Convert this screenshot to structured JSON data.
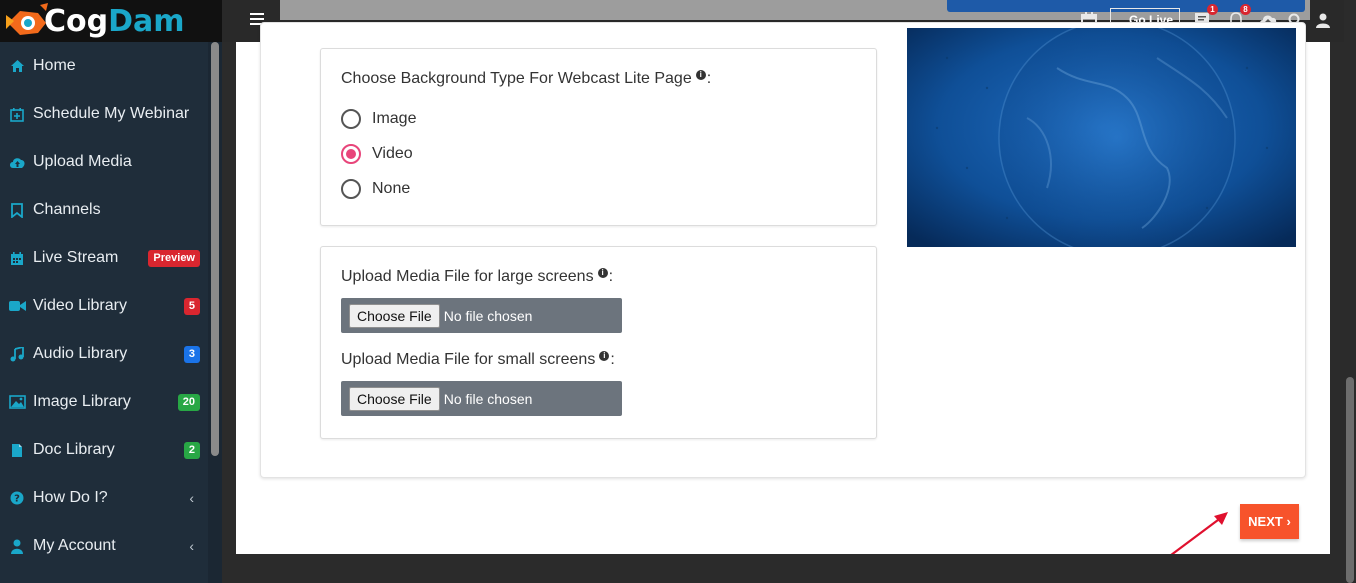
{
  "brand": {
    "name_part1": "Cog",
    "name_part2": "Dam",
    "logo_icon": "cogdam-fish-logo"
  },
  "sidebar": {
    "items": [
      {
        "label": "Home",
        "icon": "home-icon",
        "badge": null,
        "chevron": false
      },
      {
        "label": "Schedule My Webinar",
        "icon": "calendar-plus-icon",
        "badge": null,
        "chevron": false
      },
      {
        "label": "Upload Media",
        "icon": "cloud-upload-icon",
        "badge": null,
        "chevron": false
      },
      {
        "label": "Channels",
        "icon": "bookmark-icon",
        "badge": null,
        "chevron": false
      },
      {
        "label": "Live Stream",
        "icon": "calendar-icon",
        "badge": "Preview",
        "badge_color": "#d9262f",
        "chevron": false
      },
      {
        "label": "Video Library",
        "icon": "video-camera-icon",
        "badge": "5",
        "badge_color": "#d9262f",
        "chevron": false
      },
      {
        "label": "Audio Library",
        "icon": "music-note-icon",
        "badge": "3",
        "badge_color": "#1a73e8",
        "chevron": false
      },
      {
        "label": "Image Library",
        "icon": "image-icon",
        "badge": "20",
        "badge_color": "#28a745",
        "chevron": false
      },
      {
        "label": "Doc Library",
        "icon": "document-icon",
        "badge": "2",
        "badge_color": "#28a745",
        "chevron": false
      },
      {
        "label": "How Do I?",
        "icon": "question-circle-icon",
        "badge": null,
        "chevron": true
      },
      {
        "label": "My Account",
        "icon": "user-icon",
        "badge": null,
        "chevron": true
      }
    ]
  },
  "topbar": {
    "go_live_label": "Go Live",
    "messages_count": "1",
    "notifications_count": "8"
  },
  "background_panel": {
    "question": "Choose Background Type For Webcast Lite Page",
    "colon": ":",
    "options": [
      {
        "label": "Image",
        "checked": false
      },
      {
        "label": "Video",
        "checked": true
      },
      {
        "label": "None",
        "checked": false
      }
    ]
  },
  "upload_panel": {
    "large_label": "Upload Media File for large screens",
    "small_label": "Upload Media File for small screens",
    "colon": ":",
    "choose_file_label": "Choose File",
    "no_file_text": "No file chosen"
  },
  "next_button": {
    "label": "NEXT",
    "arrow": "›"
  },
  "colors": {
    "accent": "#f7532b",
    "radio_checked": "#e8457a",
    "sidebar_bg": "#1f2d3a",
    "icon_cyan": "#1aa7c9"
  }
}
